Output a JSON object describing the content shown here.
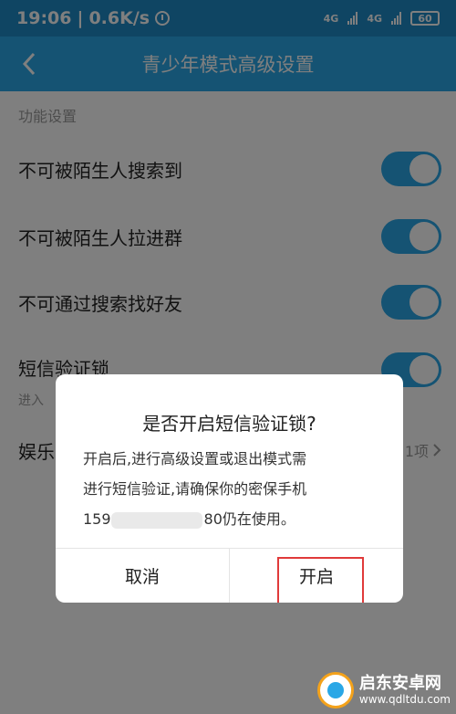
{
  "status": {
    "time": "19:06",
    "net_speed": "0.6K/s",
    "net1": "4G",
    "net2": "4G",
    "battery": "60"
  },
  "nav": {
    "title": "青少年模式高级设置"
  },
  "section": {
    "label": "功能设置"
  },
  "settings": [
    {
      "label": "不可被陌生人搜索到",
      "enabled": true
    },
    {
      "label": "不可被陌生人拉进群",
      "enabled": true
    },
    {
      "label": "不可通过搜索找好友",
      "enabled": true
    },
    {
      "label": "短信验证锁",
      "sub": "进入",
      "enabled": true
    }
  ],
  "extra_row": {
    "label": "娱乐",
    "value": "1项"
  },
  "dialog": {
    "title": "是否开启短信验证锁?",
    "line1": "开启后,进行高级设置或退出模式需",
    "line2": "进行短信验证,请确保你的密保手机",
    "line3_prefix": "159",
    "line3_suffix": "80仍在使用。",
    "cancel": "取消",
    "confirm": "开启"
  },
  "watermark": {
    "brand": "启东安卓网",
    "url": "www.qdltdu.com"
  },
  "colors": {
    "accent": "#2aa7e6",
    "statusbar": "#1f8bc6",
    "highlight": "#e03a3a"
  }
}
